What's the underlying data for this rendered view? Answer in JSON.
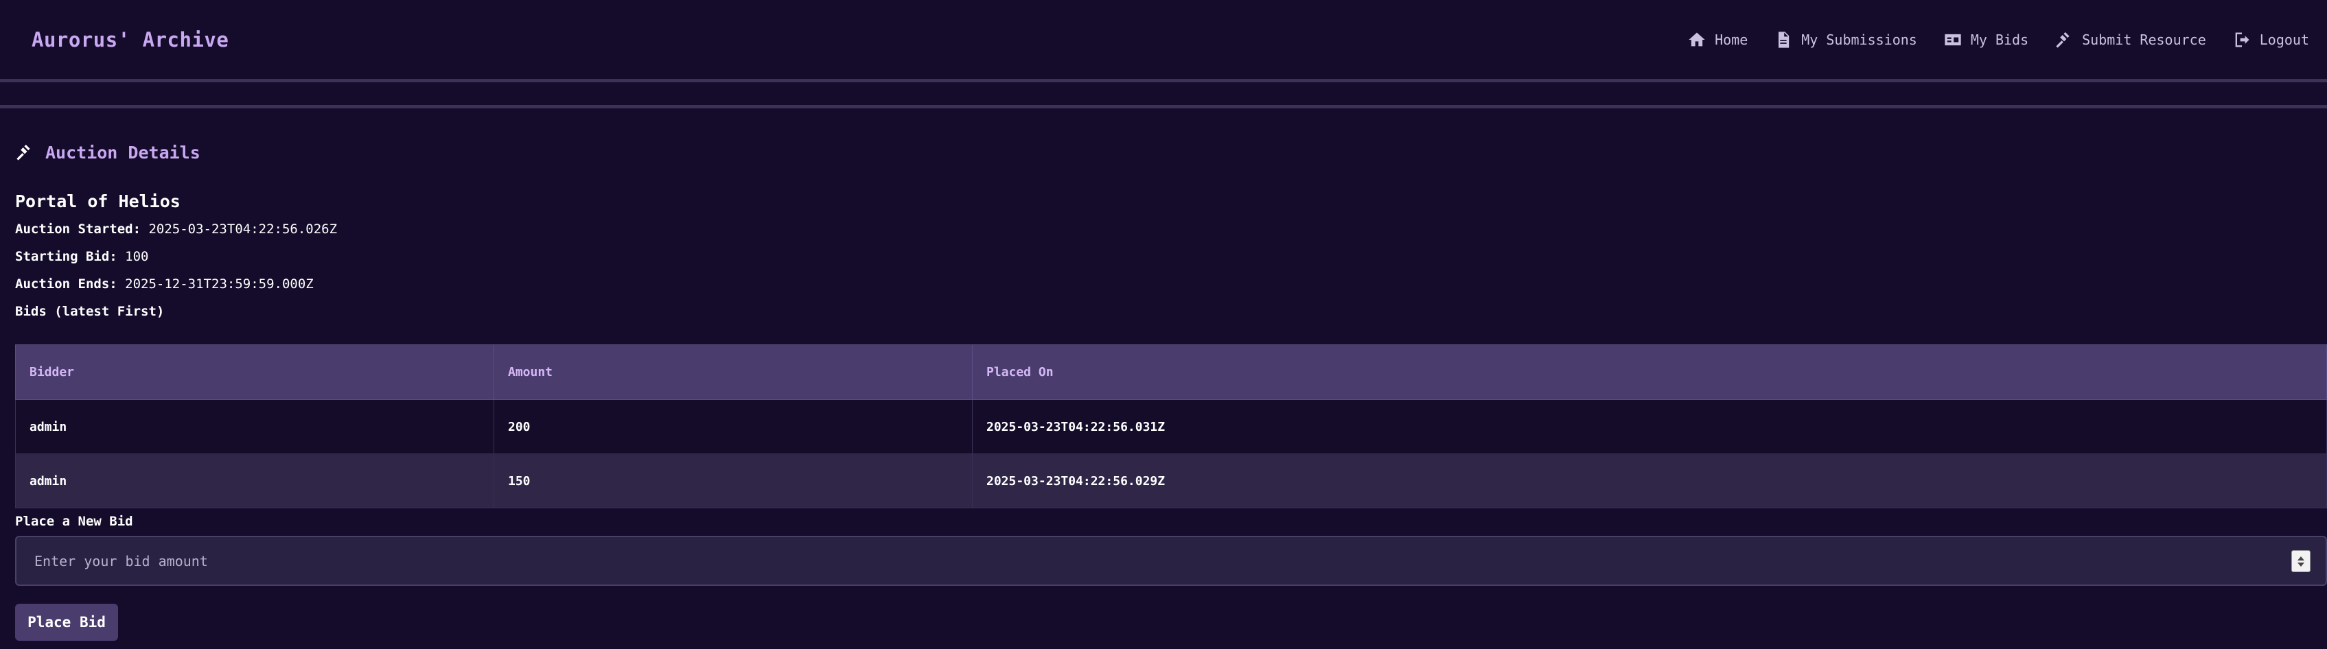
{
  "app": {
    "brand": "Aurorus' Archive"
  },
  "nav": [
    {
      "label": "Home",
      "icon": "home-icon"
    },
    {
      "label": "My Submissions",
      "icon": "document-icon"
    },
    {
      "label": "My Bids",
      "icon": "id-card-icon"
    },
    {
      "label": "Submit Resource",
      "icon": "gavel-icon"
    },
    {
      "label": "Logout",
      "icon": "logout-icon"
    }
  ],
  "section": {
    "title": "Auction Details",
    "icon": "gavel-icon"
  },
  "auction": {
    "resource_title": "Portal of Helios",
    "started_label": "Auction Started:",
    "started_value": "2025-03-23T04:22:56.026Z",
    "starting_bid_label": "Starting Bid:",
    "starting_bid_value": "100",
    "ends_label": "Auction Ends:",
    "ends_value": "2025-12-31T23:59:59.000Z",
    "bids_heading": "Bids (latest First)"
  },
  "bids_table": {
    "headers": [
      "Bidder",
      "Amount",
      "Placed On"
    ],
    "rows": [
      {
        "bidder": "admin",
        "amount": "200",
        "placed_on": "2025-03-23T04:22:56.031Z"
      },
      {
        "bidder": "admin",
        "amount": "150",
        "placed_on": "2025-03-23T04:22:56.029Z"
      }
    ]
  },
  "bid_form": {
    "label": "Place a New Bid",
    "placeholder": "Enter your bid amount",
    "value": "",
    "submit_label": "Place Bid"
  },
  "colors": {
    "background": "#140c2a",
    "accent": "#c8a8f0",
    "table_header": "#4a3d6e",
    "button": "#4a3d6e"
  }
}
